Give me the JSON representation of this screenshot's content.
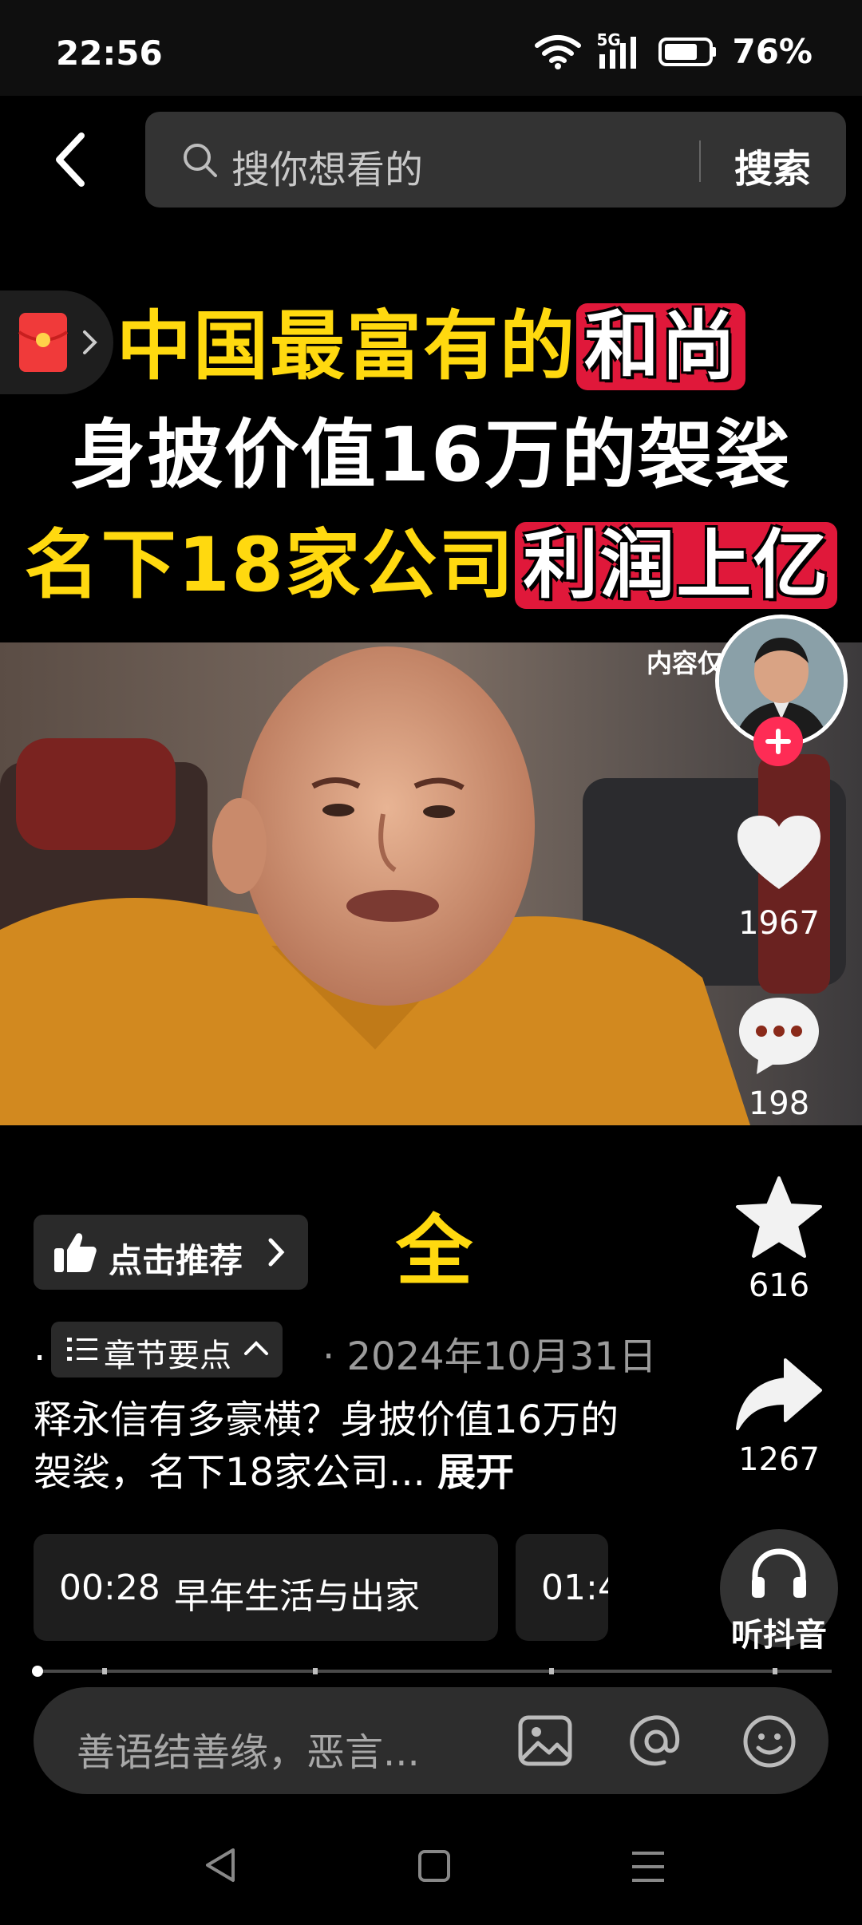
{
  "status_bar": {
    "time": "22:56",
    "network": "5G",
    "battery": "76%"
  },
  "search": {
    "placeholder": "搜你想看的",
    "button": "搜索"
  },
  "video": {
    "title_lines": [
      {
        "parts": [
          {
            "text": "中国最富有的",
            "style": "yellow"
          },
          {
            "text": "和尚",
            "style": "red"
          }
        ]
      },
      {
        "parts": [
          {
            "text": "身披价值16万的袈裟",
            "style": "white"
          }
        ]
      },
      {
        "parts": [
          {
            "text": "名下18家公司",
            "style": "yellow"
          },
          {
            "text": "利润上亿",
            "style": "red"
          }
        ]
      }
    ],
    "content_note": "内容仅",
    "caption_char": "全"
  },
  "right_rail": {
    "likes": "1967",
    "comments": "198",
    "favorites": "616",
    "shares": "1267",
    "listen_label": "听抖音"
  },
  "recommend": {
    "label": "点击推荐"
  },
  "meta": {
    "chapter_label": "章节要点",
    "date": "· 2024年10月31日"
  },
  "description": {
    "text": "释永信有多豪横？身披价值16万的袈裟，名下18家公司...",
    "expand": "展开"
  },
  "chapters": [
    {
      "time": "00:28",
      "title": "早年生活与出家"
    },
    {
      "time": "01:4",
      "title": ""
    }
  ],
  "comment": {
    "placeholder": "善语结善缘，恶言..."
  },
  "colors": {
    "accent_yellow": "#ffd90f",
    "accent_red": "#e0183a",
    "follow_pink": "#fe2c55"
  }
}
